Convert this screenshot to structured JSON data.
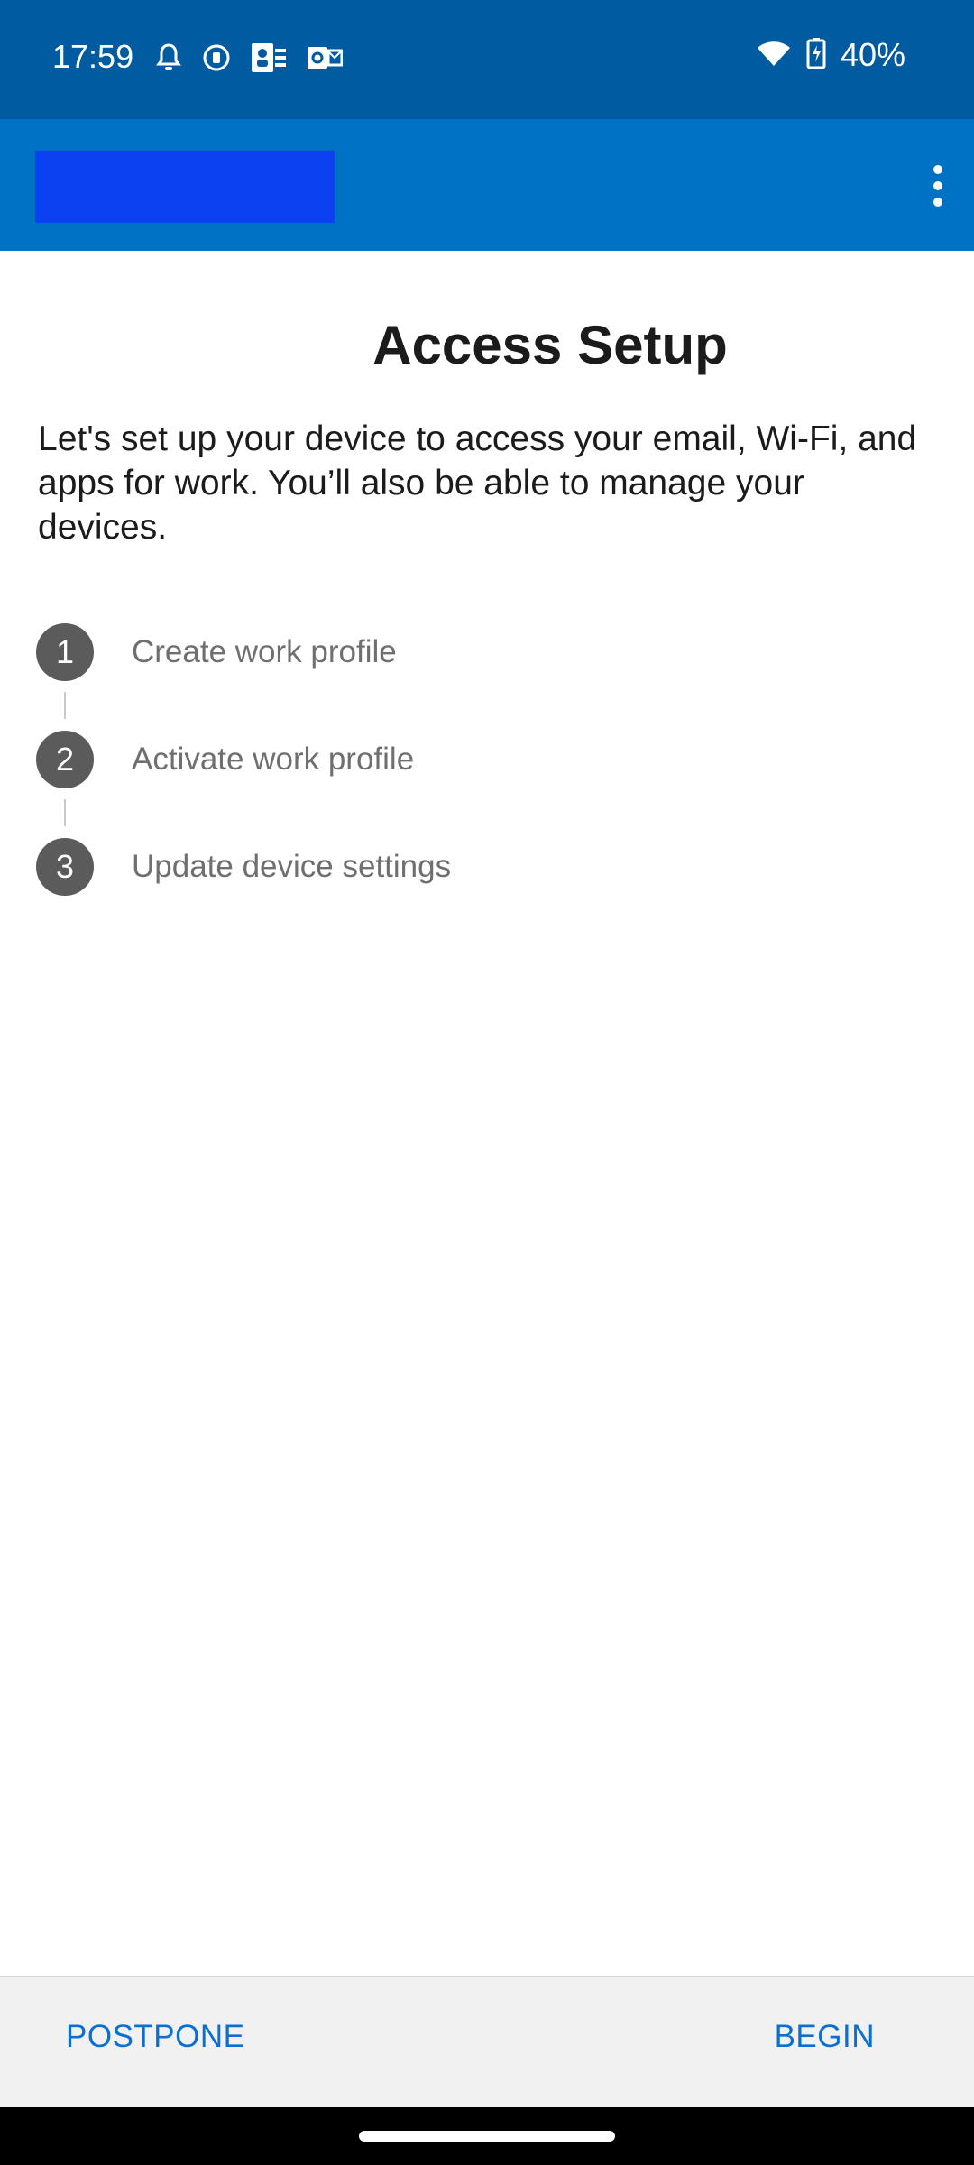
{
  "status_bar": {
    "time": "17:59",
    "battery": "40%",
    "icons_left": [
      "bell-icon",
      "vpn-icon",
      "teams-icon",
      "outlook-icon"
    ],
    "icons_right": [
      "wifi-icon",
      "battery-charging-icon"
    ]
  },
  "app_bar": {
    "background": "#0072c6",
    "logo_color": "#0b41f0",
    "menu_icon": "more-vert-icon"
  },
  "content": {
    "title": "Access Setup",
    "intro": "Let's set up your device to access your email, Wi-Fi, and apps for work. You’ll also be able to manage your devices."
  },
  "steps": [
    {
      "number": "1",
      "label": "Create work profile"
    },
    {
      "number": "2",
      "label": "Activate work profile"
    },
    {
      "number": "3",
      "label": "Update device settings"
    }
  ],
  "actions": {
    "postpone": "POSTPONE",
    "begin": "BEGIN",
    "accent": "#0a6fd1"
  }
}
